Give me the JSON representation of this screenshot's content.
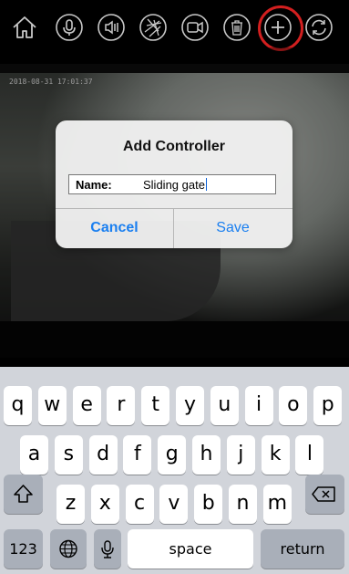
{
  "toolbar": {
    "buttons": [
      {
        "name": "home-icon"
      },
      {
        "name": "microphone-icon"
      },
      {
        "name": "speaker-icon"
      },
      {
        "name": "camera-shutter-icon"
      },
      {
        "name": "video-record-icon"
      },
      {
        "name": "trash-icon"
      },
      {
        "name": "plus-icon"
      },
      {
        "name": "refresh-icon"
      }
    ],
    "highlight_color": "#d21f1f"
  },
  "video": {
    "timestamp": "2018-08-31 17:01:37"
  },
  "dialog": {
    "title": "Add Controller",
    "name_label": "Name:",
    "name_value": "Sliding gate",
    "cancel_label": "Cancel",
    "save_label": "Save",
    "button_color": "#1a7ff0"
  },
  "keyboard": {
    "row1": [
      "q",
      "w",
      "e",
      "r",
      "t",
      "y",
      "u",
      "i",
      "o",
      "p"
    ],
    "row2": [
      "a",
      "s",
      "d",
      "f",
      "g",
      "h",
      "j",
      "k",
      "l"
    ],
    "row3": [
      "z",
      "x",
      "c",
      "v",
      "b",
      "n",
      "m"
    ],
    "numbers_label": "123",
    "space_label": "space",
    "return_label": "return"
  }
}
